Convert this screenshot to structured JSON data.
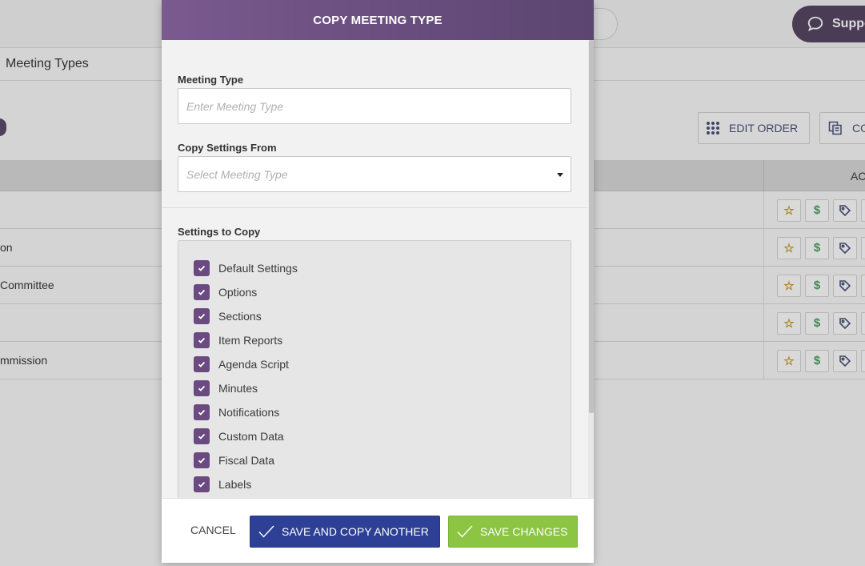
{
  "background": {
    "support_label": "Suppo",
    "breadcrumb": "Meeting Types",
    "toolbar": {
      "edit_order_label": "EDIT ORDER",
      "copy_label": "CO"
    },
    "table": {
      "actions_header": "AC",
      "rows": [
        "",
        "on",
        "Committee",
        "",
        "mmission"
      ]
    }
  },
  "modal": {
    "title": "COPY MEETING TYPE",
    "meeting_type": {
      "label": "Meeting Type",
      "value": "",
      "placeholder": "Enter Meeting Type"
    },
    "copy_from": {
      "label": "Copy Settings From",
      "placeholder": "Select Meeting Type"
    },
    "settings_to_copy": {
      "label": "Settings to Copy",
      "items": [
        {
          "label": "Default Settings",
          "checked": true
        },
        {
          "label": "Options",
          "checked": true
        },
        {
          "label": "Sections",
          "checked": true
        },
        {
          "label": "Item Reports",
          "checked": true
        },
        {
          "label": "Agenda Script",
          "checked": true
        },
        {
          "label": "Minutes",
          "checked": true
        },
        {
          "label": "Notifications",
          "checked": true
        },
        {
          "label": "Custom Data",
          "checked": true
        },
        {
          "label": "Fiscal Data",
          "checked": true
        },
        {
          "label": "Labels",
          "checked": true
        }
      ]
    },
    "footer": {
      "cancel_label": "CANCEL",
      "save_copy_label": "SAVE AND COPY ANOTHER",
      "save_label": "SAVE CHANGES"
    }
  },
  "colors": {
    "header_purple": "#6a4f80",
    "checkbox_purple": "#6a4a80",
    "primary_blue": "#2e3f96",
    "success_green": "#8cc542"
  }
}
